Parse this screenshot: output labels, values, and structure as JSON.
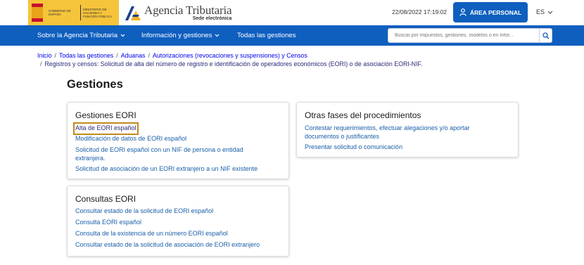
{
  "header": {
    "gov_logo_line1": "GOBIERNO DE ESPAÑA",
    "gov_logo_line2": "MINISTERIO DE HACIENDA Y FUNCIÓN PÚBLICA",
    "site_title": "Agencia Tributaria",
    "site_subtitle": "Sede electrónica",
    "datetime": "22/08/2022 17:19:02",
    "area_button": "ÁREA PERSONAL",
    "language": "ES"
  },
  "nav": {
    "items": [
      {
        "label": "Sobre la Agencia Tributaria"
      },
      {
        "label": "Información y gestiones"
      },
      {
        "label": "Todas las gestiones"
      }
    ],
    "search_placeholder": "Buscar por impuestos, gestiones, modelos o en Infor..."
  },
  "breadcrumb": [
    "Inicio",
    "Todas las gestiones",
    "Aduanas",
    "Autorizaciones (revocaciones y suspensiones) y Censos",
    "Registros y censos: Solicitud de alta del número de registro e identificación de operadores económicos (EORI) o de asociación EORI-NIF."
  ],
  "page_title": "Gestiones",
  "cards": {
    "gestiones": {
      "title": "Gestiones EORI",
      "links": [
        "Alta de EORI español",
        "Modificación de datos de EORI español",
        "Solicitud de EORI español con un NIF de persona o entidad extranjera.",
        "Solicitud de asociación de un EORI extranjero a un NIF existente"
      ]
    },
    "otras": {
      "title": "Otras fases del procedimientos",
      "links": [
        "Contestar requerimientos, efectuar alegaciones y/o aportar documentos o justificantes",
        "Presentar solicitud o comunicación"
      ]
    },
    "consultas": {
      "title": "Consultas EORI",
      "links": [
        "Consultar estado de la solicitud de EORI español",
        "Consulta EORI español",
        "Consulta de la existencia de un número EORI español",
        "Consultar estado de la solicitud de asociación de EORI extranjero"
      ]
    }
  },
  "colors": {
    "brand_blue": "#0f5fbf",
    "link": "#1a5fa8",
    "gov_yellow": "#f6c43a",
    "focus_outline": "#c08a1e"
  },
  "icons": [
    "chevron-down-icon",
    "user-icon",
    "search-icon",
    "coat-of-arms-icon",
    "agencia-tributaria-logo-icon"
  ]
}
